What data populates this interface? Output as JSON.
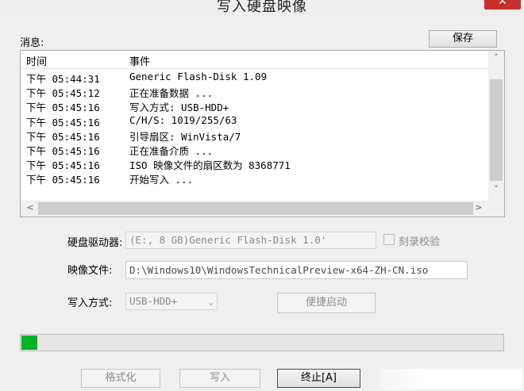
{
  "window": {
    "title": "写入硬盘映像",
    "close_glyph": "✕"
  },
  "messages": {
    "label": "消息:",
    "save_label": "保存",
    "columns": [
      "时间",
      "事件"
    ],
    "rows": [
      {
        "time": "下午 05:44:31",
        "event": "Generic Flash-Disk      1.09"
      },
      {
        "time": "下午 05:45:12",
        "event": "正在准备数据 ..."
      },
      {
        "time": "下午 05:45:16",
        "event": "写入方式: USB-HDD+"
      },
      {
        "time": "下午 05:45:16",
        "event": "C/H/S: 1019/255/63"
      },
      {
        "time": "下午 05:45:16",
        "event": "引导扇区: WinVista/7"
      },
      {
        "time": "下午 05:45:16",
        "event": "正在准备介质 ..."
      },
      {
        "time": "下午 05:45:16",
        "event": "ISO 映像文件的扇区数为 8368771"
      },
      {
        "time": "下午 05:45:16",
        "event": "开始写入 ..."
      }
    ],
    "scroll_up": "˄",
    "scroll_down": "˅",
    "scroll_left": "<",
    "scroll_right": ">"
  },
  "form": {
    "drive_label": "硬盘驱动器:",
    "drive_value": "(E:, 8 GB)Generic Flash-Disk      1.0'",
    "drive_chevron": "⌄",
    "verify_label": "刻录校验",
    "verify_checked": false,
    "image_label": "映像文件:",
    "image_value": "D:\\Windows10\\WindowsTechnicalPreview-x64-ZH-CN.iso",
    "method_label": "写入方式:",
    "method_value": "USB-HDD+",
    "method_chevron": "⌄",
    "quick_boot_label": "便捷启动"
  },
  "progress": {
    "fraction": 0.033,
    "color": "#06b025"
  },
  "actions": {
    "format_label": "格式化",
    "write_label": "写入",
    "abort_label": "终止[A]"
  },
  "colors": {
    "close_button": "#c7302a",
    "window_bg": "#f0f0f0"
  }
}
